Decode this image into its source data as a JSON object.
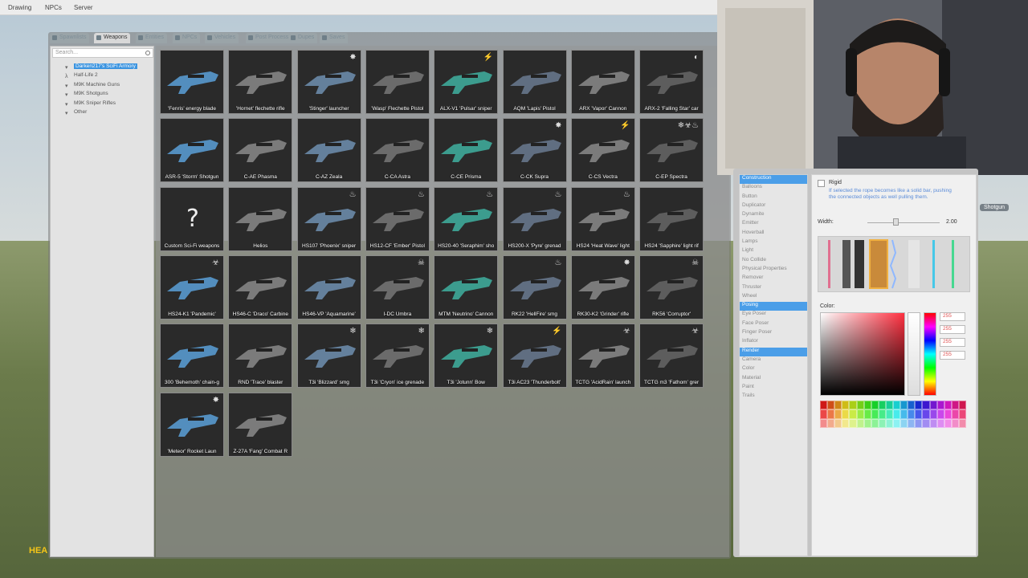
{
  "menubar": {
    "items": [
      "Drawing",
      "NPCs",
      "Server"
    ]
  },
  "tabs": [
    "Spawnlists",
    "Weapons",
    "Entities",
    "NPCs",
    "Vehicles",
    "Post Process",
    "Dupes",
    "Saves"
  ],
  "search": {
    "placeholder": "Search..."
  },
  "tree": [
    {
      "label": "Darken217's SciFi Armory",
      "selected": true
    },
    {
      "label": "Half-Life 2",
      "selected": false
    },
    {
      "label": "M9K Machine Guns",
      "selected": false
    },
    {
      "label": "M9K Shotguns",
      "selected": false
    },
    {
      "label": "M9K Sniper Rifles",
      "selected": false
    },
    {
      "label": "Other",
      "selected": false
    }
  ],
  "weapons": [
    "'Fenris' energy blade",
    "'Hornet' flechette rifle",
    "'Stinger' launcher",
    "'Wasp' Flechette Pistol",
    "ALX-V1 'Pulsar' sniper",
    "AQM 'Lapis' Pistol",
    "ARX 'Vapor' Cannon",
    "ARX-2 'Falling Star' car",
    "ASR-5 'Storm' Shotgun",
    "C-AE Phasma",
    "C-AZ Zeala",
    "C-CA Astra",
    "C-CE Prisma",
    "C-CK Supra",
    "C-CS Vectra",
    "C-EP Spectra",
    "Custom Sci-Fi weapons",
    "Helios",
    "HS107 'Phoenix' sniper",
    "HS12-CF 'Ember' Pistol",
    "HS20-40 'Seraphim' sho",
    "HS200-X 'Pyre' grenad",
    "HS24 'Heat Wave' light",
    "HS24 'Sapphire' light rif",
    "HS24-K1 'Pandemic'",
    "HS46-C 'Draco' Carbine",
    "HS46-VP 'Aquamarine'",
    "I-DC Umbra",
    "MTM 'Neutrino' Cannon",
    "RK22 'HellFire' smg",
    "RK30-K2 'Grinder' rifle",
    "RK56 'Corruptor'",
    "300 'Behemoth' chain-g",
    "RND 'Trace' blaster",
    "T3i 'Blizzard' smg",
    "T3i 'Cryon' ice grenade",
    "T3i 'Jotunn' Bow",
    "T3i AC23 'Thunderbolt'",
    "TCTG 'AcidRain' launch",
    "TCTG m3 'Fathom' grer",
    "'Meteor' Rocket Laun",
    "Z-27A 'Fang' Combat R"
  ],
  "effects": [
    "",
    "",
    "✸",
    "",
    "⚡",
    "",
    "",
    "◐",
    "",
    "",
    "",
    "",
    "",
    "✸",
    "⚡",
    "❄☣♨",
    "",
    "",
    "♨",
    "♨",
    "♨",
    "♨",
    "♨",
    "",
    "☣",
    "",
    "",
    "☠",
    "",
    "♨",
    "✸",
    "☠",
    "",
    "",
    "❄",
    "❄",
    "❄",
    "⚡",
    "☣",
    "☣",
    "✸",
    ""
  ],
  "tools": [
    {
      "label": "Construction",
      "cat": true
    },
    {
      "label": "Balloons"
    },
    {
      "label": "Button"
    },
    {
      "label": "Duplicator"
    },
    {
      "label": "Dynamite"
    },
    {
      "label": "Emitter"
    },
    {
      "label": "Hoverball"
    },
    {
      "label": "Lamps"
    },
    {
      "label": "Light"
    },
    {
      "label": "No Collide"
    },
    {
      "label": "Physical Properties"
    },
    {
      "label": "Remover"
    },
    {
      "label": "Thruster"
    },
    {
      "label": "Wheel"
    },
    {
      "label": "Posing",
      "cat": true
    },
    {
      "label": "Eye Poser"
    },
    {
      "label": "Face Poser"
    },
    {
      "label": "Finger Poser"
    },
    {
      "label": "Inflator"
    },
    {
      "label": "Render",
      "cat": true
    },
    {
      "label": "Camera"
    },
    {
      "label": "Color"
    },
    {
      "label": "Material"
    },
    {
      "label": "Paint"
    },
    {
      "label": "Trails"
    }
  ],
  "toolpanel": {
    "rigid_label": "Rigid",
    "rigid_help": "If selected the rope becomes like a solid bar, pushing the connected objects as well pulling them.",
    "width_label": "Width:",
    "width_value": "2.00",
    "color_label": "Color:",
    "rgba": [
      "255",
      "255",
      "255",
      "255"
    ]
  },
  "hud": {
    "text": "HEA",
    "weapon_label": "Shotgun"
  },
  "colors": {
    "selection": "#3b94e0",
    "category": "#4b9ee8",
    "accent": "#f5c518"
  }
}
